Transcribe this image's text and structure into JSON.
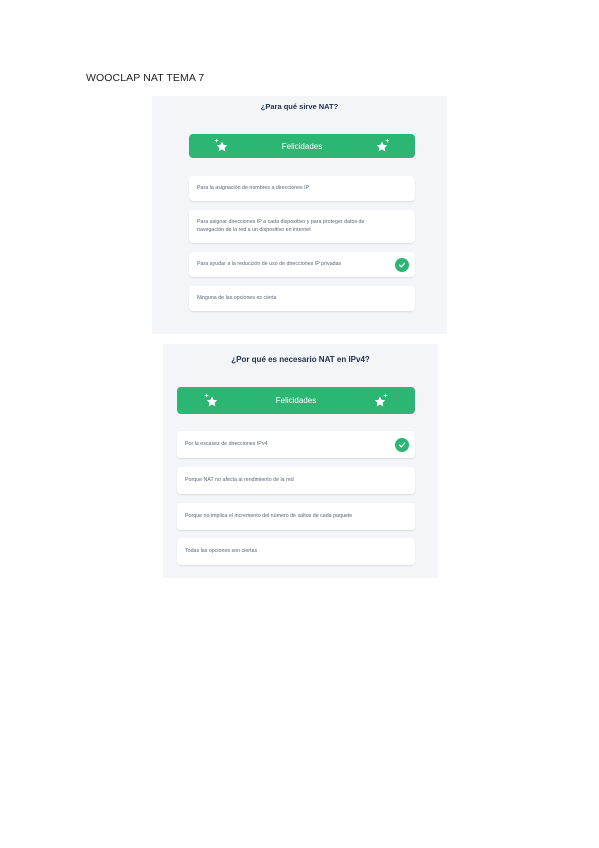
{
  "document": {
    "title": "WOOCLAP NAT TEMA 7"
  },
  "colors": {
    "success_green": "#2bb673",
    "card_bg": "#f3f5f8",
    "option_bg": "#ffffff"
  },
  "quiz1": {
    "question": "¿Para qué sirve NAT?",
    "banner": {
      "label": "Felicidades",
      "icon": "sparkle-star-icon"
    },
    "options": [
      {
        "text": "Para la asignación de nombres a direcciones IP",
        "correct": false
      },
      {
        "text": "Para asignar direcciones IP a cada dispositivo y para proteger datos de navegación de la red a un dispositivo en internet",
        "correct": false
      },
      {
        "text": "Para ayudar a la reducción de uso de direcciones IP privadas",
        "correct": true
      },
      {
        "text": "Ninguna de las opciones es cierta",
        "correct": false
      }
    ]
  },
  "quiz2": {
    "question": "¿Por qué es necesario NAT en IPv4?",
    "banner": {
      "label": "Felicidades",
      "icon": "sparkle-star-icon"
    },
    "options": [
      {
        "text": "Por la escasez de direcciones IPv4",
        "correct": true
      },
      {
        "text": "Porque NAT no afecta al rendimiento de la red",
        "correct": false
      },
      {
        "text": "Porque no implica el incremento del número de saltos de cada paquete",
        "correct": false
      },
      {
        "text": "Todas las opciones son ciertas",
        "correct": false
      }
    ]
  }
}
